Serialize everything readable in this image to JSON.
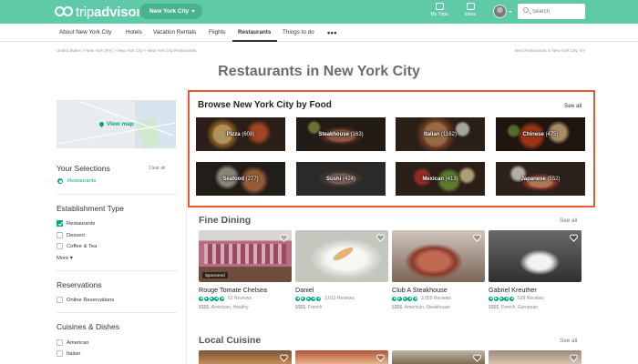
{
  "header": {
    "logo_light": "trip",
    "logo_bold": "advisor",
    "location": "New York City",
    "my_trips": "My Trips",
    "inbox": "Inbox",
    "search_placeholder": "Search"
  },
  "nav": {
    "items": [
      "About New York City",
      "Hotels",
      "Vacation Rentals",
      "Flights",
      "Restaurants",
      "Things to do"
    ],
    "active": "Restaurants",
    "more": "•••"
  },
  "breadcrumb": {
    "path": "United States  >  New York (NY)  >  New York City  >  New York City Restaurants",
    "right": "Best Restaurants in New York City, NY"
  },
  "page": {
    "title": "Restaurants in New York City"
  },
  "sidebar": {
    "view_map": "View map",
    "your_selections": "Your Selections",
    "clear_all": "Clear all",
    "selected": "Restaurants",
    "establishment": {
      "title": "Establishment Type",
      "options": [
        {
          "label": "Restaurants",
          "checked": true
        },
        {
          "label": "Dessert",
          "checked": false
        },
        {
          "label": "Coffee & Tea",
          "checked": false
        }
      ],
      "more": "More ▾"
    },
    "reservations": {
      "title": "Reservations",
      "options": [
        {
          "label": "Online Reservations",
          "checked": false
        }
      ]
    },
    "cuisines": {
      "title": "Cuisines & Dishes",
      "options": [
        {
          "label": "American",
          "checked": false
        },
        {
          "label": "Italian",
          "checked": false
        }
      ]
    }
  },
  "browse": {
    "title": "Browse New York City by Food",
    "see_all": "See all",
    "tiles": [
      {
        "name": "Pizza",
        "count": "(608)"
      },
      {
        "name": "Steakhouse",
        "count": "(163)"
      },
      {
        "name": "Italian",
        "count": "(1162)"
      },
      {
        "name": "Chinese",
        "count": "(475)"
      },
      {
        "name": "Seafood",
        "count": "(277)"
      },
      {
        "name": "Sushi",
        "count": "(424)"
      },
      {
        "name": "Mexican",
        "count": "(413)"
      },
      {
        "name": "Japanese",
        "count": "(552)"
      }
    ]
  },
  "fine_dining": {
    "title": "Fine Dining",
    "see_all": "See all",
    "cards": [
      {
        "name": "Rouge Tomate Chelsea",
        "reviews": "62 Reviews",
        "meta": "$$$$, American, Healthy",
        "badge": "Sponsored"
      },
      {
        "name": "Daniel",
        "reviews": "3,013 Reviews",
        "meta": "$$$$, French",
        "badge": ""
      },
      {
        "name": "Club A Steakhouse",
        "reviews": "3,059 Reviews",
        "meta": "$$$$, American, Steakhouse",
        "badge": ""
      },
      {
        "name": "Gabriel Kreuther",
        "reviews": "529 Reviews",
        "meta": "$$$$, French, European",
        "badge": ""
      }
    ]
  },
  "local_cuisine": {
    "title": "Local Cuisine",
    "see_all": "See all"
  },
  "colors": {
    "brand": "#5fc9a8",
    "accent_green": "#00a680",
    "highlight_border": "#e65a2d"
  }
}
